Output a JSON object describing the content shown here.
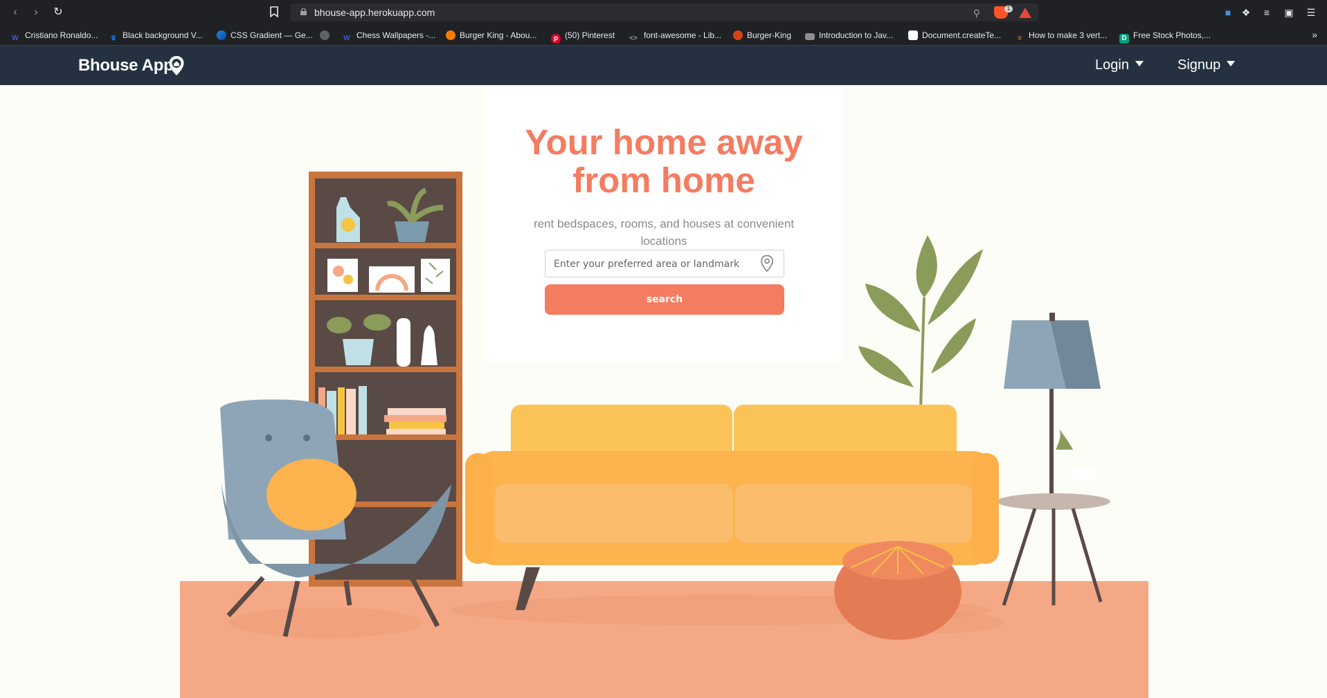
{
  "browser": {
    "url": "bhouse-app.herokuapp.com",
    "brave_badge": "1",
    "bookmarks": [
      {
        "label": "Cristiano Ronaldo...",
        "icon": "w-icon",
        "color": "#3b5bdb"
      },
      {
        "label": "Black background V...",
        "icon": "crown-icon",
        "color": "#1967d2"
      },
      {
        "label": "CSS Gradient — Ge...",
        "icon": "gradient-icon",
        "color": "#1e88e5"
      },
      {
        "label": "",
        "icon": "globe-icon",
        "color": "#5f6368"
      },
      {
        "label": "Chess Wallpapers -...",
        "icon": "w-icon",
        "color": "#3b5bdb"
      },
      {
        "label": "Burger King - Abou...",
        "icon": "burger-icon",
        "color": "#f57c00"
      },
      {
        "label": "(50) Pinterest",
        "icon": "pinterest-icon",
        "color": "#e60023"
      },
      {
        "label": "font-awesome - Lib...",
        "icon": "code-icon",
        "color": "#9aa0a6"
      },
      {
        "label": "Burger-King",
        "icon": "burger-icon",
        "color": "#d84315"
      },
      {
        "label": "Introduction to Jav...",
        "icon": "laptop-icon",
        "color": "#8d8d8d"
      },
      {
        "label": "Document.createTe...",
        "icon": "document-icon",
        "color": "#ffffff"
      },
      {
        "label": "How to make 3 vert...",
        "icon": "stack-icon",
        "color": "#f48024"
      },
      {
        "label": "Free Stock Photos,...",
        "icon": "photo-icon",
        "color": "#05a081"
      }
    ]
  },
  "navbar": {
    "brand": "Bhouse App",
    "login": "Login",
    "signup": "Signup"
  },
  "hero": {
    "title_line1": "Your home away",
    "title_line2": "from home",
    "subtitle": "rent bedspaces, rooms, and houses at convenient locations",
    "search_placeholder": "Enter your preferred area or landmark",
    "search_button": "search"
  },
  "colors": {
    "navbar": "#253141",
    "accent": "#f47c61",
    "background": "#fdfdf7"
  }
}
